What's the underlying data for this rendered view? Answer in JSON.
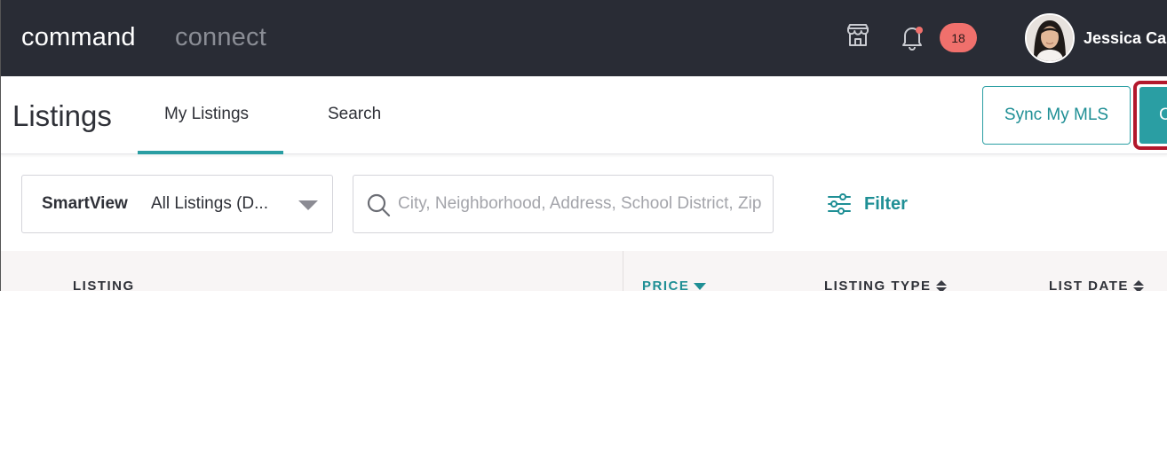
{
  "topbar": {
    "brand_primary": "command",
    "brand_secondary": "connect",
    "notification_count": "18",
    "user_name": "Jessica Ca",
    "colors": {
      "background": "#292c35",
      "badge": "#f0706c"
    },
    "icons": [
      "store-icon",
      "bell-icon"
    ]
  },
  "header": {
    "title": "Listings",
    "tabs": [
      {
        "label": "My Listings",
        "active": true
      },
      {
        "label": "Search",
        "active": false
      }
    ],
    "sync_button": "Sync My MLS",
    "create_button": "C",
    "accent_color": "#2a9ea3",
    "highlight_color": "#b3182c"
  },
  "filters": {
    "smartview_label": "SmartView",
    "smartview_value": "All Listings (D...",
    "search_placeholder": "City, Neighborhood, Address, School District, Zip",
    "filter_label": "Filter"
  },
  "table": {
    "columns": [
      {
        "label": "LISTING",
        "sort": "none"
      },
      {
        "label": "PRICE",
        "sort": "desc"
      },
      {
        "label": "LISTING TYPE",
        "sort": "sortable"
      },
      {
        "label": "LIST DATE",
        "sort": "sortable"
      }
    ]
  }
}
